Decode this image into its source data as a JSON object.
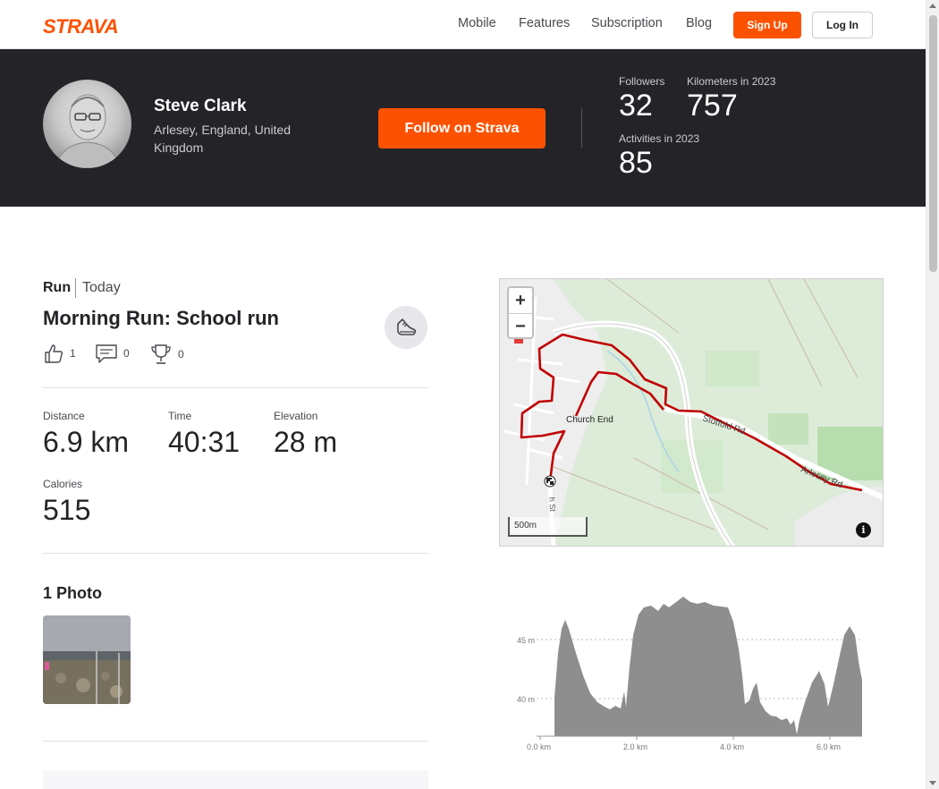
{
  "nav": {
    "logo": "STRAVA",
    "links": [
      "Mobile",
      "Features",
      "Subscription",
      "Blog"
    ],
    "signup_label": "Sign Up",
    "login_label": "Log In",
    "brand_color": "#fc5200"
  },
  "athlete": {
    "name": "Steve Clark",
    "location": "Arlesey, England, United Kingdom",
    "follow_label": "Follow on Strava",
    "stats": {
      "followers_label": "Followers",
      "followers": "32",
      "km_label": "Kilometers in 2023",
      "km": "757",
      "activities_label": "Activities in 2023",
      "activities": "85"
    }
  },
  "activity": {
    "type": "Run",
    "date": "Today",
    "title": "Morning Run: School run",
    "kudos": "1",
    "comments": "0",
    "achievements": "0",
    "metrics": {
      "distance_label": "Distance",
      "distance": "6.9 km",
      "time_label": "Time",
      "time": "40:31",
      "elevation_label": "Elevation",
      "elevation": "28 m",
      "calories_label": "Calories",
      "calories": "515"
    },
    "photos_heading": "1 Photo"
  },
  "map": {
    "zoom_in": "+",
    "zoom_out": "−",
    "scale_label": "500m",
    "info": "i",
    "labels": {
      "place": "Church End",
      "road1": "Stotfold Rd",
      "road2": "Arlesey Rd",
      "road3": "h St"
    },
    "route_color": "#c00000"
  },
  "elevation": {
    "y_ticks": [
      "45 m",
      "40 m"
    ],
    "x_ticks": [
      "0.0 km",
      "2.0 km",
      "4.0 km",
      "6.0 km"
    ]
  }
}
